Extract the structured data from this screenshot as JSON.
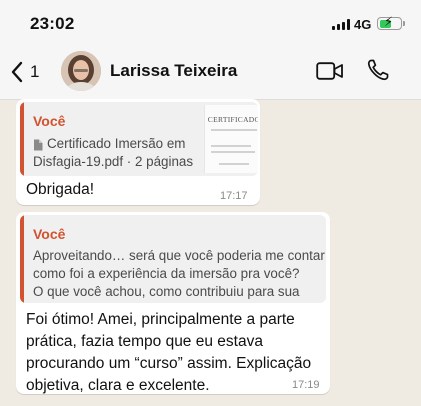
{
  "status_bar": {
    "time": "23:02",
    "network": "4G",
    "battery_level": 0.6,
    "battery_charging": true,
    "battery_color": "#34c759"
  },
  "header": {
    "back_count": "1",
    "contact_name": "Larissa Teixeira",
    "icons": [
      "chevron-left-icon",
      "video-camera-icon",
      "phone-icon"
    ]
  },
  "messages": [
    {
      "quote": {
        "author": "Você",
        "doc_name_line1": "Certificado Imersão em",
        "doc_name_line2": "Disfagia-19.pdf · 2 páginas",
        "thumb_title": "CERTIFICADO"
      },
      "text": "Obrigada!",
      "time": "17:17"
    },
    {
      "quote": {
        "author": "Você",
        "lines": [
          "Aproveitando… será que você poderia me contar",
          "como foi a experiência da imersão pra você?",
          "O que você achou, como contribuiu para sua prá…"
        ]
      },
      "text_lines": [
        "Foi ótimo! Amei, principalmente a parte",
        "prática, fazia tempo que eu estava",
        "procurando um “curso” assim. Explicação",
        "objetiva, clara e excelente."
      ],
      "time": "17:19"
    }
  ],
  "colors": {
    "chat_background": "#efeae2",
    "quote_accent": "#d1532f",
    "bubble": "#ffffff"
  }
}
